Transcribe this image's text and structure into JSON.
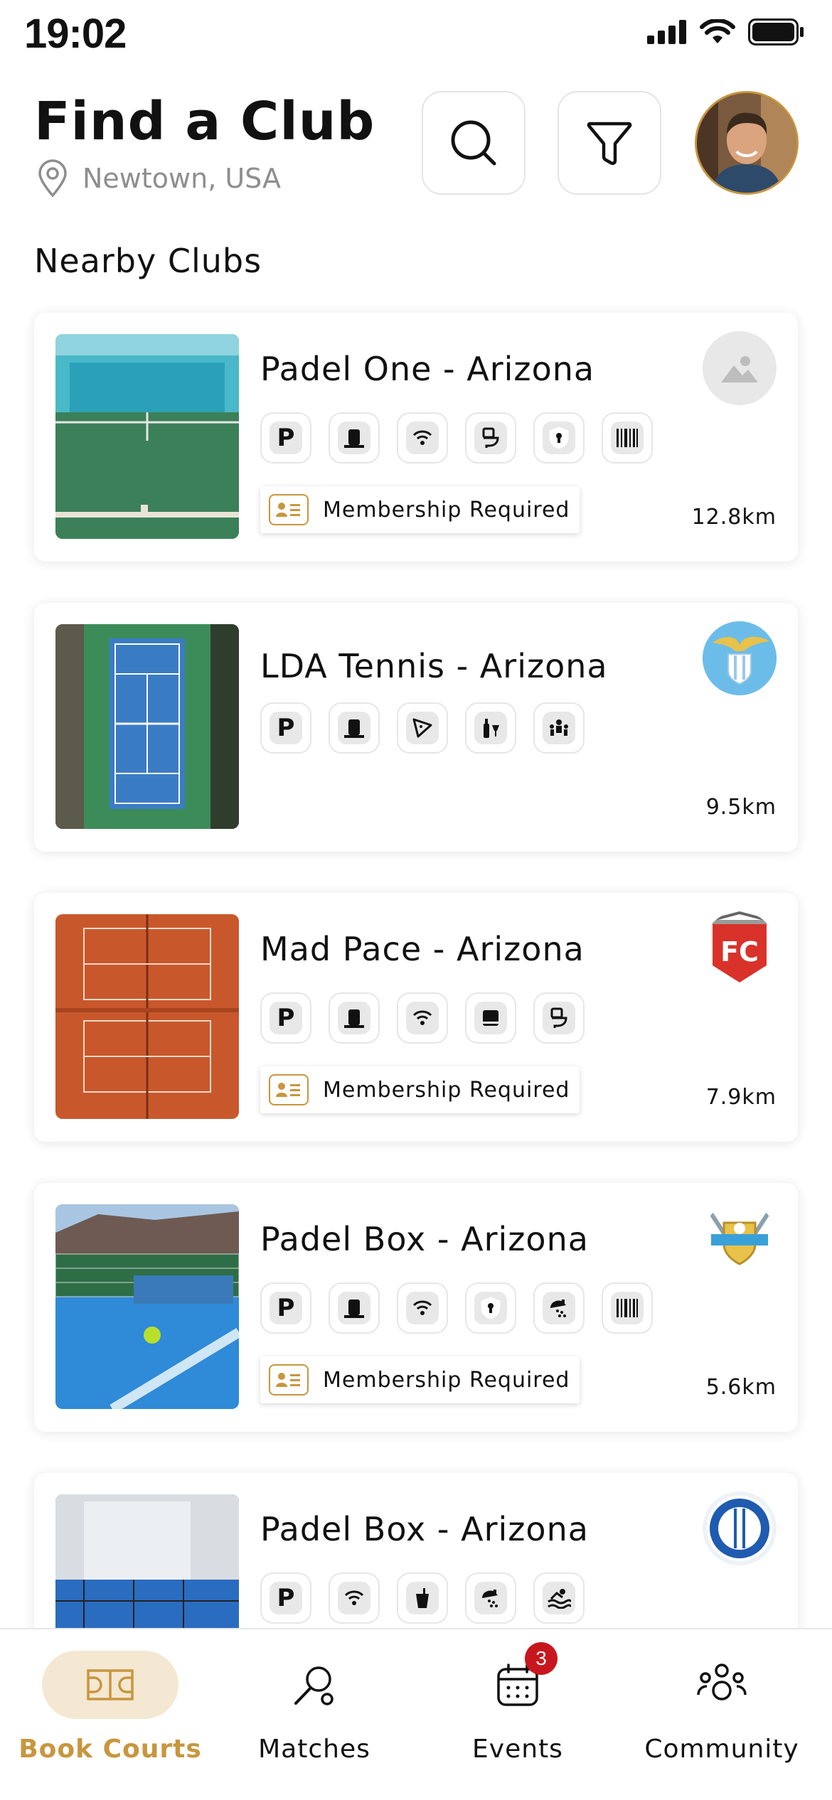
{
  "status_bar": {
    "time": "19:02"
  },
  "header": {
    "title": "Find a Club",
    "location": "Newtown, USA"
  },
  "section_title": "Nearby Clubs",
  "colors": {
    "accent": "#c8963e",
    "badge": "#c8161e"
  },
  "clubs": [
    {
      "name": "Padel One - Arizona",
      "distance": "12.8km",
      "membership": "Membership Required",
      "amenities": [
        "parking-icon",
        "locker-icon",
        "wifi-icon",
        "toilet-icon",
        "security-icon",
        "barcode-icon"
      ],
      "logo": "placeholder-image-icon"
    },
    {
      "name": "LDA Tennis - Arizona",
      "distance": "9.5km",
      "amenities": [
        "parking-icon",
        "locker-icon",
        "food-icon",
        "bar-icon",
        "kids-icon"
      ],
      "logo": "eagle-crest-logo"
    },
    {
      "name": "Mad Pace - Arizona",
      "distance": "7.9km",
      "membership": "Membership Required",
      "amenities": [
        "parking-icon",
        "locker-icon",
        "wifi-icon",
        "lounge-icon",
        "toilet-icon"
      ],
      "logo": "fc-pennant-logo"
    },
    {
      "name": "Padel Box - Arizona",
      "distance": "5.6km",
      "membership": "Membership Required",
      "amenities": [
        "parking-icon",
        "locker-icon",
        "wifi-icon",
        "security-icon",
        "shower-icon",
        "barcode-icon"
      ],
      "logo": "golf-shield-logo"
    },
    {
      "name": "Padel Box - Arizona",
      "amenities": [
        "parking-icon",
        "wifi-icon",
        "drink-icon",
        "shower-icon",
        "pool-icon"
      ],
      "logo": "blue-ring-logo"
    }
  ],
  "nav": {
    "items": [
      {
        "label": "Book Courts",
        "icon": "court-icon",
        "active": true
      },
      {
        "label": "Matches",
        "icon": "racket-icon"
      },
      {
        "label": "Events",
        "icon": "calendar-icon",
        "badge": "3"
      },
      {
        "label": "Community",
        "icon": "people-icon"
      }
    ]
  }
}
